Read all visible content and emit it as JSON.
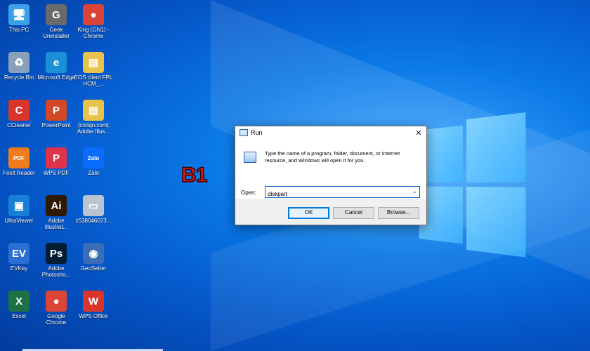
{
  "desktop": {
    "icons": [
      {
        "label": "This PC",
        "icon": "this-pc-icon",
        "color": "#3aa0e8",
        "glyph": "🖥"
      },
      {
        "label": "Geek Uninstaller",
        "icon": "geek-uninstaller-icon",
        "color": "#6a6a6a",
        "glyph": "G"
      },
      {
        "label": "King (GN1) - Chrome",
        "icon": "chrome-icon",
        "color": "#db4437",
        "glyph": "●"
      },
      {
        "label": "Recycle Bin",
        "icon": "recycle-bin-icon",
        "color": "#8aa0b8",
        "glyph": "♻"
      },
      {
        "label": "Microsoft Edge",
        "icon": "edge-icon",
        "color": "#1b8fd8",
        "glyph": "e"
      },
      {
        "label": "EOS client FPL HCM_...",
        "icon": "folder-icon",
        "color": "#e8c24a",
        "glyph": "▤"
      },
      {
        "label": "CCleaner",
        "icon": "ccleaner-icon",
        "color": "#d9352b",
        "glyph": "C"
      },
      {
        "label": "PowerPoint",
        "icon": "powerpoint-icon",
        "color": "#d24726",
        "glyph": "P"
      },
      {
        "label": "[cnttqn.com] Adobe Illus...",
        "icon": "folder-icon",
        "color": "#e8c24a",
        "glyph": "▤"
      },
      {
        "label": "Foxit Reader",
        "icon": "foxit-reader-icon",
        "color": "#f07c1b",
        "glyph": "PDF"
      },
      {
        "label": "WPS PDF",
        "icon": "wps-pdf-icon",
        "color": "#e0324b",
        "glyph": "P"
      },
      {
        "label": "Zalo",
        "icon": "zalo-icon",
        "color": "#0a6cff",
        "glyph": "Zalo"
      },
      {
        "label": "UltraViewer",
        "icon": "ultraviewer-icon",
        "color": "#1780d6",
        "glyph": "▣"
      },
      {
        "label": "Adobe Illustrat...",
        "icon": "illustrator-icon",
        "color": "#2e1a00",
        "glyph": "Ai"
      },
      {
        "label": "z538046073...",
        "icon": "image-file-icon",
        "color": "#b8c4cf",
        "glyph": "▭"
      },
      {
        "label": "EVKey",
        "icon": "evkey-icon",
        "color": "#2a6fd1",
        "glyph": "EV"
      },
      {
        "label": "Adobe Photosho...",
        "icon": "photoshop-icon",
        "color": "#001d34",
        "glyph": "Ps"
      },
      {
        "label": "GeoSetter",
        "icon": "geosetter-icon",
        "color": "#3a6db5",
        "glyph": "◉"
      },
      {
        "label": "Excel",
        "icon": "excel-icon",
        "color": "#1e7145",
        "glyph": "X"
      },
      {
        "label": "Google Chrome",
        "icon": "chrome-icon",
        "color": "#db4437",
        "glyph": "●"
      },
      {
        "label": "WPS Office",
        "icon": "wps-office-icon",
        "color": "#d9352b",
        "glyph": "W"
      }
    ]
  },
  "annotation": {
    "label": "B1",
    "color": "#d41c1c"
  },
  "run_dialog": {
    "title": "Run",
    "close_glyph": "✕",
    "description": "Type the name of a program, folder, document, or Internet resource, and Windows will open it for you.",
    "open_label": "Open:",
    "open_value": "diskpart",
    "ok_label": "OK",
    "cancel_label": "Cancel",
    "browse_label": "Browse..."
  }
}
